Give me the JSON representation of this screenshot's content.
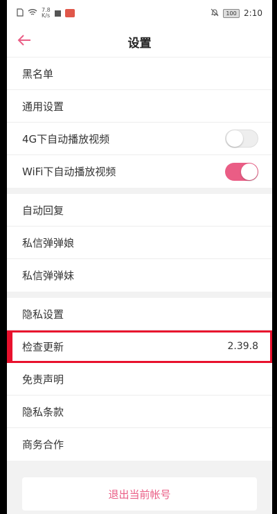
{
  "status_bar": {
    "net_speed_value": "7.8",
    "net_speed_unit": "K/s",
    "battery": "100",
    "time": "2:10"
  },
  "header": {
    "title": "设置",
    "back_icon": "arrow-left-icon"
  },
  "groups": [
    {
      "items": [
        {
          "label": "黑名单"
        },
        {
          "label": "通用设置"
        },
        {
          "label": "4G下自动播放视频",
          "toggle": false
        },
        {
          "label": "WiFi下自动播放视频",
          "toggle": true
        }
      ]
    },
    {
      "items": [
        {
          "label": "自动回复"
        },
        {
          "label": "私信弹弹娘"
        },
        {
          "label": "私信弹弹妹"
        }
      ]
    },
    {
      "items": [
        {
          "label": "隐私设置"
        },
        {
          "label": "检查更新",
          "value": "2.39.8"
        },
        {
          "label": "免责声明"
        },
        {
          "label": "隐私条款"
        },
        {
          "label": "商务合作"
        }
      ]
    }
  ],
  "logout_label": "退出当前帐号",
  "colors": {
    "accent": "#ea5d85",
    "highlight": "#e8112d"
  }
}
